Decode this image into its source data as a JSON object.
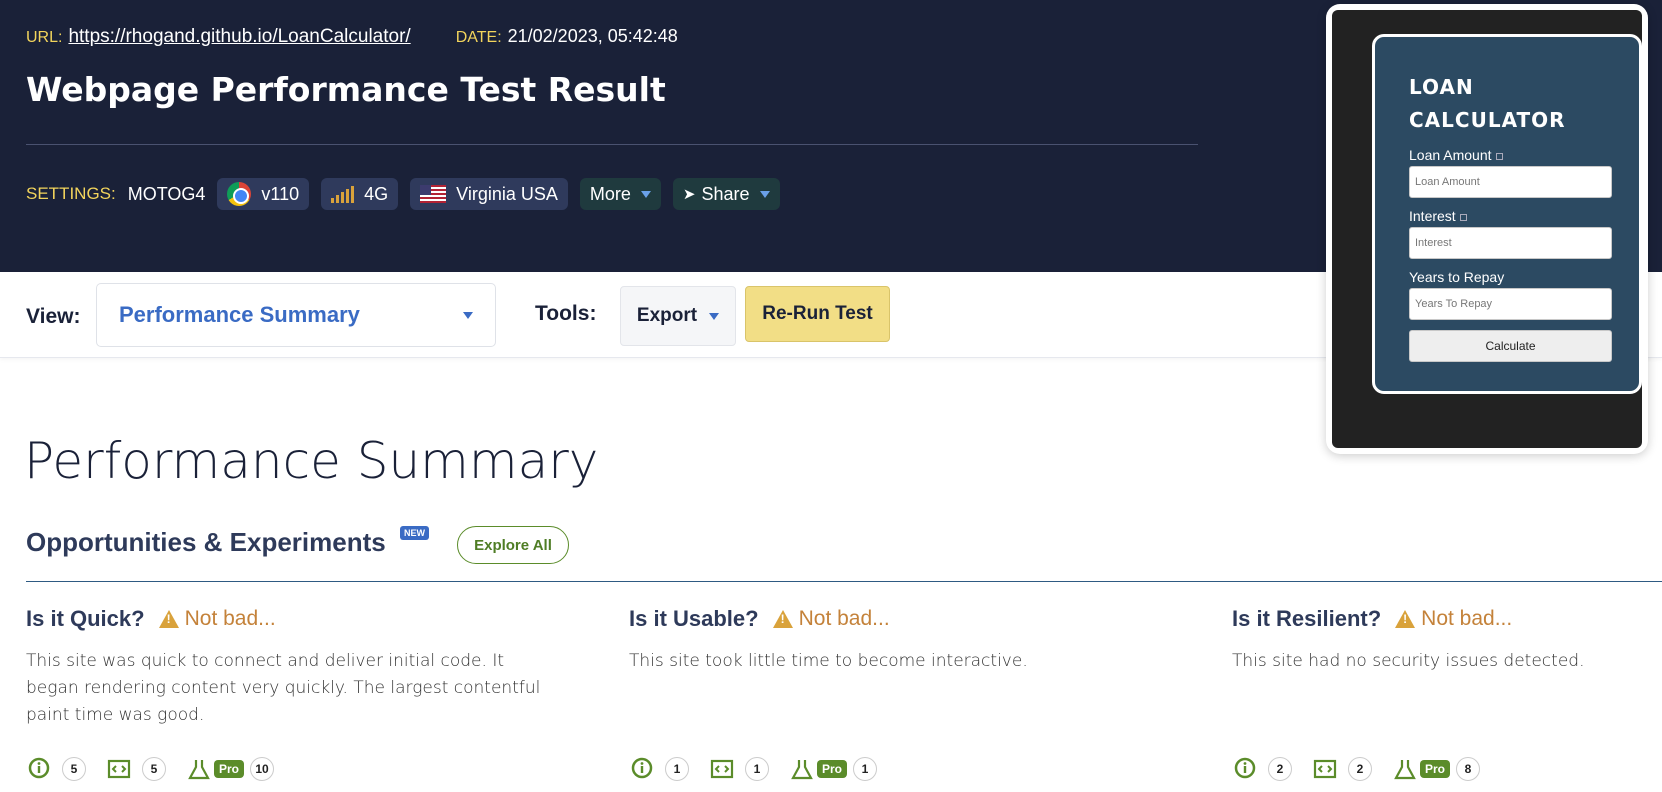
{
  "header": {
    "url_label": "URL:",
    "url": "https://rhogand.github.io/LoanCalculator/",
    "date_label": "DATE:",
    "date": "21/02/2023, 05:42:48",
    "title": "Webpage Performance Test Result",
    "settings_label": "SETTINGS:",
    "device": "MOTOG4",
    "browser": "v110",
    "connection": "4G",
    "location": "Virginia USA",
    "more": "More",
    "share": "Share"
  },
  "toolbar": {
    "view_label": "View:",
    "view_value": "Performance Summary",
    "tools_label": "Tools:",
    "export": "Export",
    "rerun": "Re-Run Test"
  },
  "preview": {
    "title_line1": "LOAN",
    "title_line2": "CALCULATOR",
    "fields": [
      {
        "label": "Loan Amount",
        "placeholder": "Loan Amount"
      },
      {
        "label": "Interest",
        "placeholder": "Interest"
      },
      {
        "label": "Years to Repay",
        "placeholder": "Years To Repay"
      }
    ],
    "button": "Calculate"
  },
  "main": {
    "title": "Performance Summary",
    "opp_title": "Opportunities & Experiments",
    "new_badge": "NEW",
    "explore": "Explore All",
    "pro_label": "Pro",
    "cards": [
      {
        "question": "Is it Quick?",
        "status": "Not bad...",
        "desc": "This site was quick to connect and deliver initial code. It began rendering content very quickly. The largest contentful paint time was good.",
        "counts": [
          "5",
          "5",
          "10"
        ]
      },
      {
        "question": "Is it Usable?",
        "status": "Not bad...",
        "desc": "This site took little time to become interactive.",
        "counts": [
          "1",
          "1",
          "1"
        ]
      },
      {
        "question": "Is it Resilient?",
        "status": "Not bad...",
        "desc": "This site had no security issues detected.",
        "counts": [
          "2",
          "2",
          "8"
        ]
      }
    ]
  },
  "colors": {
    "header_bg": "#1a2138",
    "accent_yellow": "#f2d45c",
    "link_blue": "#3a6bc4",
    "green": "#5b8c2a",
    "warning": "#c4823a"
  }
}
